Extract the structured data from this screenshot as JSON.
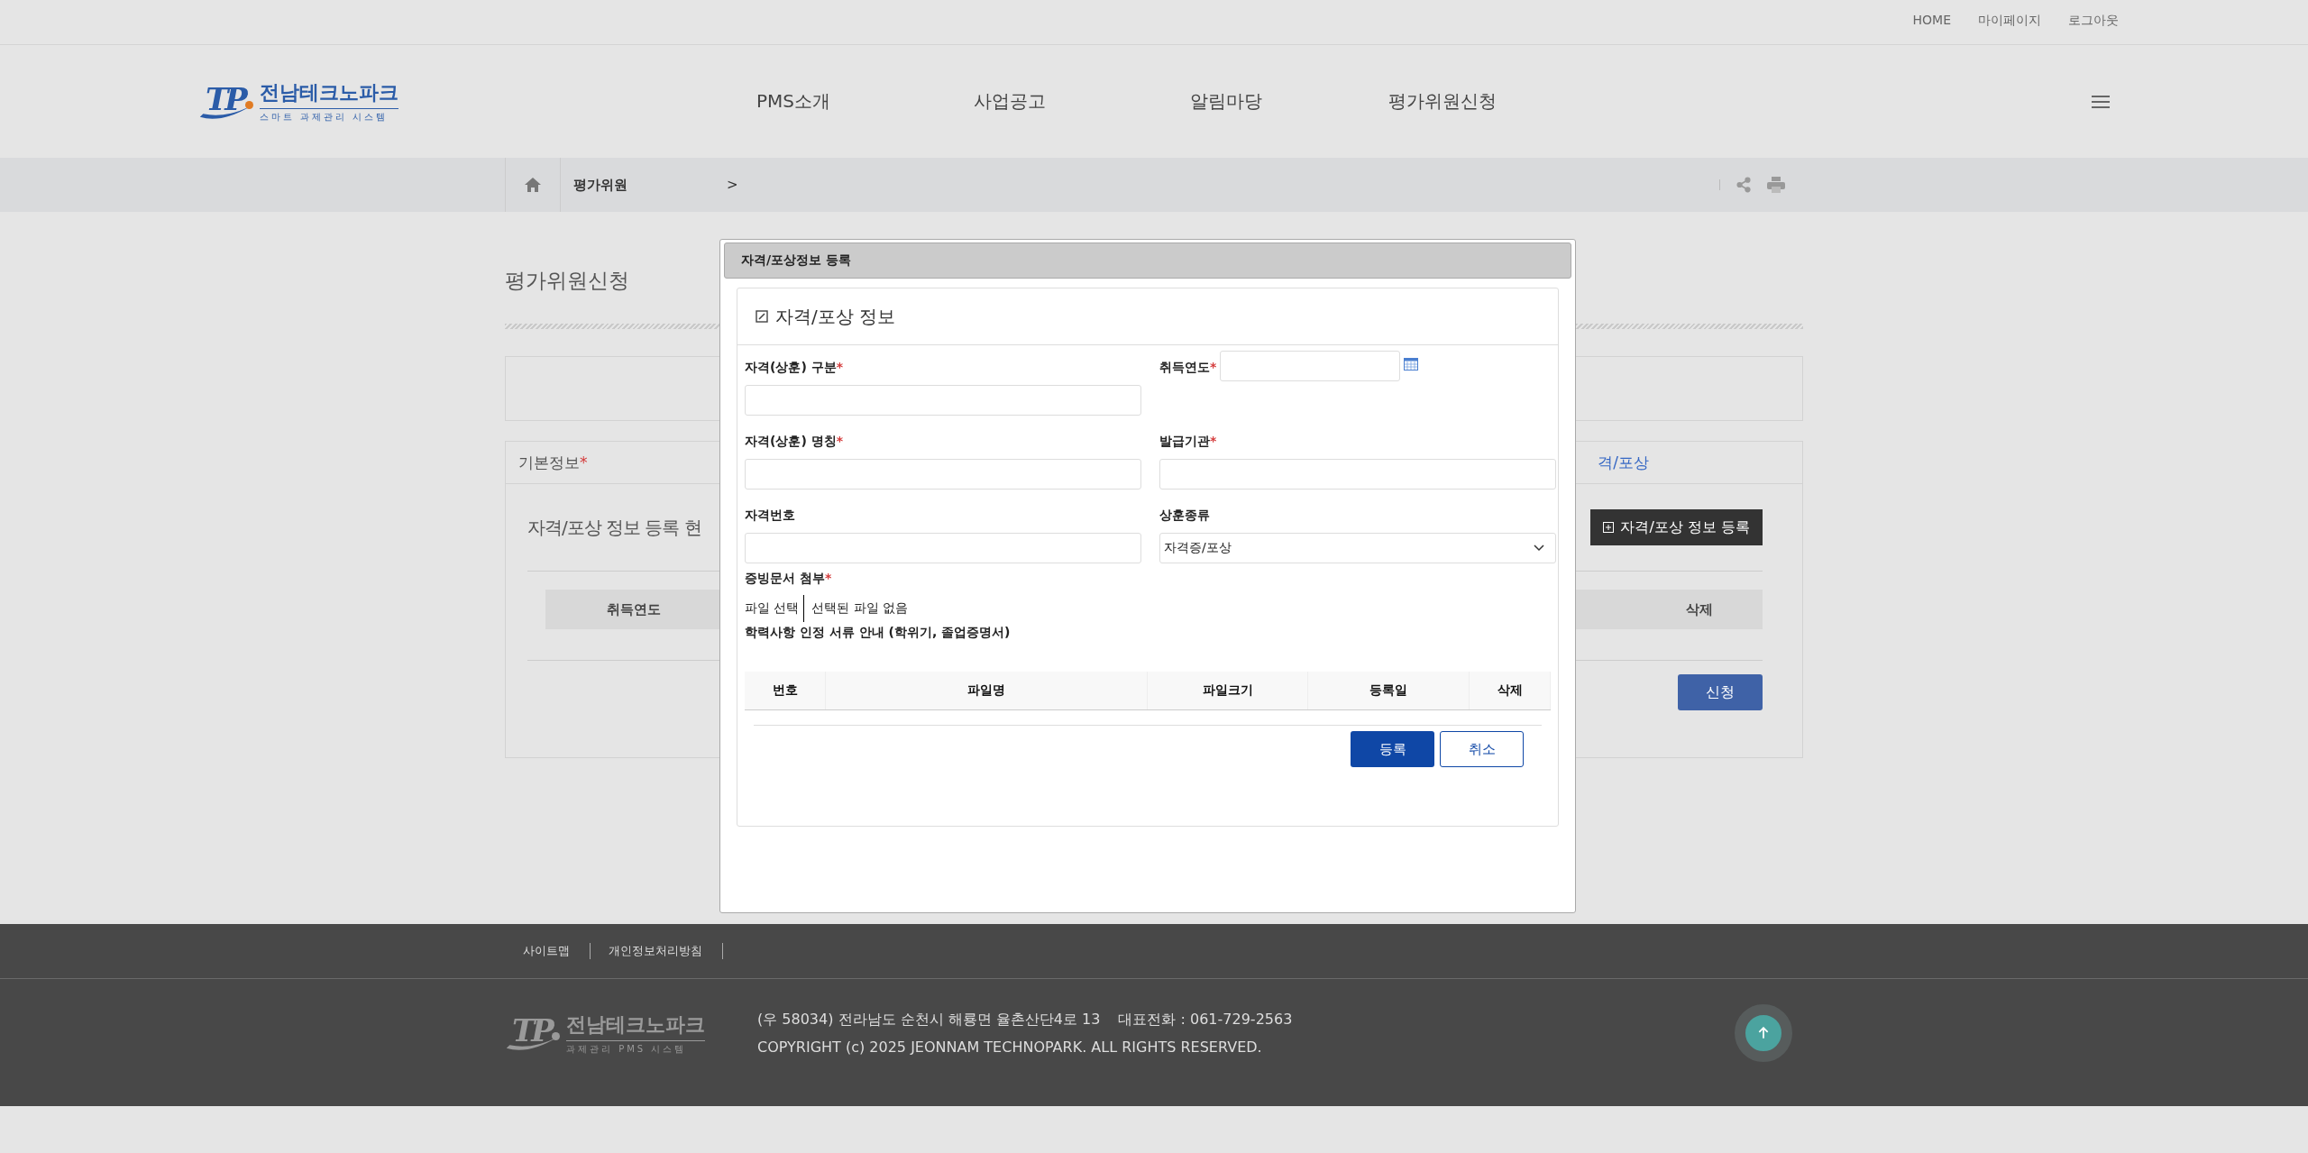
{
  "top_links": [
    "HOME",
    "마이페이지",
    "로그아웃"
  ],
  "logo": {
    "mark": "TP",
    "name": "전남테크노파크",
    "subtitle": "스마트 과제관리 시스템"
  },
  "nav": [
    "PMS소개",
    "사업공고",
    "알림마당",
    "평가위원신청"
  ],
  "breadcrumb": {
    "current": "평가위원",
    "separator": ">"
  },
  "page": {
    "title": "평가위원신청",
    "tabs": [
      {
        "label": "기본정보",
        "mark": "*",
        "selected": false
      },
      {
        "label": "격/포상",
        "selected": true
      }
    ],
    "panel": {
      "title": "자격/포상 정보 등록 현",
      "add_button": "자격/포상 정보 등록",
      "columns": [
        "취득연도",
        "삭제"
      ],
      "submit": "신청"
    }
  },
  "modal": {
    "title": "자격/포상정보 등록",
    "section_title": "자격/포상 정보",
    "fields": [
      {
        "label": "자격(상훈) 구분",
        "mark": "*",
        "kind": "text"
      },
      {
        "label": "취득연도",
        "mark": "*",
        "kind": "date"
      },
      {
        "label": "자격(상훈) 명칭",
        "mark": "*",
        "kind": "text"
      },
      {
        "label": "발급기관",
        "mark": "*",
        "kind": "text"
      },
      {
        "label": "자격번호",
        "kind": "text"
      },
      {
        "label": "상훈종류",
        "kind": "select",
        "value": "자격증/포상"
      }
    ],
    "attachment": {
      "label": "증빙문서 첨부",
      "mark": "*",
      "button": "파일 선택",
      "status": "선택된 파일 없음",
      "note": "학력사항 인정 서류 안내 (학위기, 졸업증명서)"
    },
    "file_columns": [
      "번호",
      "파일명",
      "파일크기",
      "등록일",
      "삭제"
    ],
    "buttons": [
      {
        "label": "등록",
        "kind": "primary"
      },
      {
        "label": "취소",
        "kind": "secondary"
      }
    ]
  },
  "footer": {
    "links": [
      "사이트맵",
      "개인정보처리방침"
    ],
    "logo": {
      "mark": "TP",
      "name": "전남테크노파크",
      "subtitle": "과제관리 PMS 시스템"
    },
    "address": "(우 58034) 전라남도 순천시 해룡면 율촌산단4로 13",
    "phone": "대표전화 : 061-729-2563",
    "copyright": "COPYRIGHT (c) 2025 JEONNAM TECHNOPARK. ALL RIGHTS RESERVED."
  }
}
